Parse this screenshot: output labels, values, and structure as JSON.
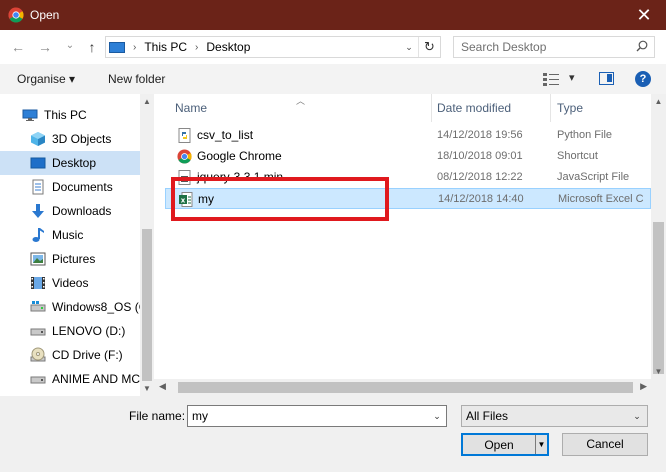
{
  "window": {
    "title": "Open",
    "close_glyph": "✕"
  },
  "nav": {
    "back_glyph": "←",
    "forward_glyph": "→",
    "recent_glyph": "⌄",
    "up_glyph": "↑"
  },
  "address": {
    "breadcrumbs": [
      "This PC",
      "Desktop"
    ],
    "separator": "›",
    "dropdown_glyph": "⌄",
    "refresh_glyph": "↻"
  },
  "search": {
    "placeholder": "Search Desktop"
  },
  "toolbar": {
    "organise_label": "Organise ▾",
    "new_folder_label": "New folder",
    "views_caret": "▾",
    "help_glyph": "?"
  },
  "sidebar": {
    "items": [
      {
        "label": "This PC",
        "icon": "pc-icon"
      },
      {
        "label": "3D Objects",
        "icon": "cube-icon"
      },
      {
        "label": "Desktop",
        "icon": "desktop-icon",
        "selected": true
      },
      {
        "label": "Documents",
        "icon": "documents-icon"
      },
      {
        "label": "Downloads",
        "icon": "download-icon"
      },
      {
        "label": "Music",
        "icon": "music-icon"
      },
      {
        "label": "Pictures",
        "icon": "pictures-icon"
      },
      {
        "label": "Videos",
        "icon": "videos-icon"
      },
      {
        "label": "Windows8_OS (C",
        "icon": "drive-icon"
      },
      {
        "label": "LENOVO (D:)",
        "icon": "drive-icon"
      },
      {
        "label": "CD Drive (F:)",
        "icon": "cd-icon"
      },
      {
        "label": "ANIME AND MC",
        "icon": "drive-icon"
      }
    ]
  },
  "columns": {
    "name": "Name",
    "date": "Date modified",
    "type": "Type"
  },
  "files": [
    {
      "name": "csv_to_list",
      "date": "14/12/2018 19:56",
      "type": "Python File",
      "icon": "python-file-icon"
    },
    {
      "name": "Google Chrome",
      "date": "18/10/2018 09:01",
      "type": "Shortcut",
      "icon": "chrome-icon"
    },
    {
      "name": "jquery-3.3.1.min",
      "date": "08/12/2018 12:22",
      "type": "JavaScript File",
      "icon": "js-file-icon"
    },
    {
      "name": "my",
      "date": "14/12/2018 14:40",
      "type": "Microsoft Excel C",
      "icon": "excel-csv-icon",
      "selected": true
    }
  ],
  "footer": {
    "file_name_label": "File name:",
    "file_name_value": "my",
    "filter_value": "All Files",
    "open_label": "Open",
    "cancel_label": "Cancel",
    "dropdown_glyph": "⌄"
  },
  "colors": {
    "titlebar": "#6b2318",
    "selection": "#cce8ff",
    "highlight": "#e0191e",
    "accent": "#0078d7"
  }
}
